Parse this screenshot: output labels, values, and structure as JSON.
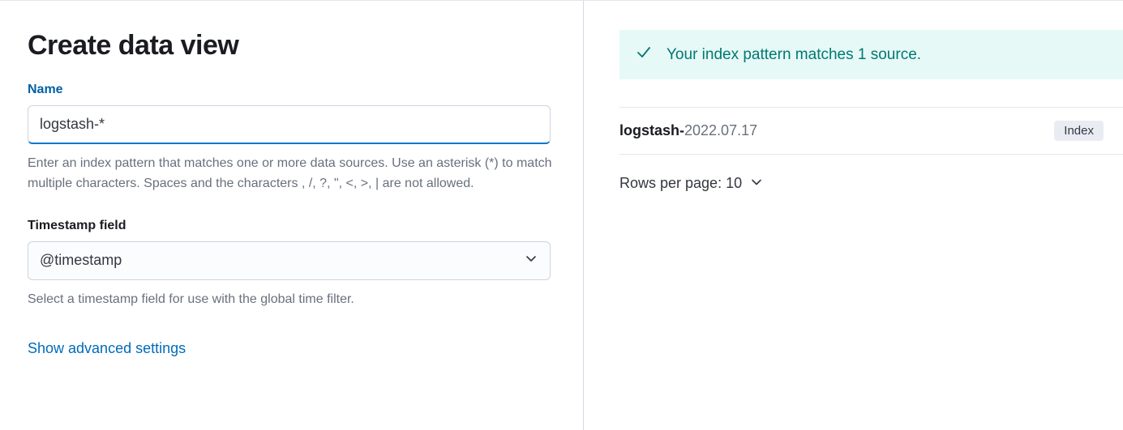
{
  "header": {
    "title": "Create data view"
  },
  "nameField": {
    "label": "Name",
    "value": "logstash-*",
    "help": "Enter an index pattern that matches one or more data sources. Use an asterisk (*) to match multiple characters. Spaces and the characters , /, ?, \", <, >, | are not allowed."
  },
  "timestampField": {
    "label": "Timestamp field",
    "value": "@timestamp",
    "help": "Select a timestamp field for use with the global time filter."
  },
  "advancedLink": {
    "label": "Show advanced settings"
  },
  "matchCallout": {
    "text": "Your index pattern matches 1 source."
  },
  "results": [
    {
      "matchedPrefix": "logstash-",
      "suffix": "2022.07.17",
      "badge": "Index"
    }
  ],
  "pager": {
    "label": "Rows per page: 10"
  }
}
